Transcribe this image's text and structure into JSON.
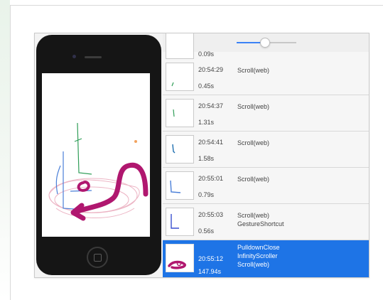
{
  "list": {
    "partial_duration": "0.09s",
    "rows": [
      {
        "time": "20:54:29",
        "gestures": [
          "Scroll(web)"
        ],
        "duration": "0.45s",
        "selected": false
      },
      {
        "time": "20:54:37",
        "gestures": [
          "Scroll(web)"
        ],
        "duration": "1.31s",
        "selected": false
      },
      {
        "time": "20:54:41",
        "gestures": [
          "Scroll(web)"
        ],
        "duration": "1.58s",
        "selected": false
      },
      {
        "time": "20:55:01",
        "gestures": [
          "Scroll(web)"
        ],
        "duration": "0.79s",
        "selected": false
      },
      {
        "time": "20:55:03",
        "gestures": [
          "Scroll(web)",
          "GestureShortcut"
        ],
        "duration": "0.56s",
        "selected": false
      },
      {
        "time": "20:55:12",
        "gestures": [
          "PulldownClose",
          "InfinityScroller",
          "Scroll(web)"
        ],
        "duration": "147.94s",
        "selected": true
      }
    ]
  },
  "colors": {
    "selection": "#1e74e6",
    "gesture_stroke": "#b0176f",
    "trace_pink": "#e8a2b6",
    "trace_blue": "#4a7fd8",
    "trace_green": "#2f9d57",
    "slider_accent": "#3b82f6"
  },
  "icons": {
    "home_button": "home-button-icon",
    "slider": "zoom-slider"
  }
}
